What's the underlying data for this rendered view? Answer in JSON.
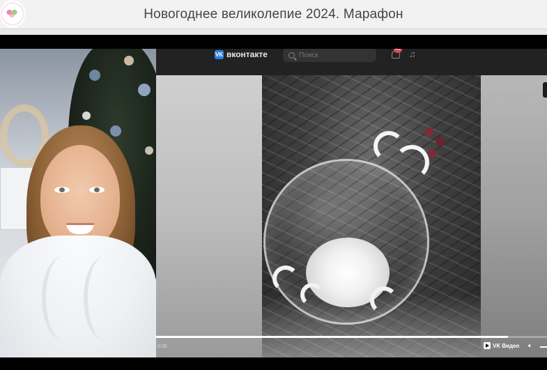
{
  "header": {
    "title": "Новогоднее великолепие 2024. Марафон",
    "logo_icon": "flower-logo-icon",
    "background": "#f2f2f2"
  },
  "vk": {
    "brand_name": "вконтакте",
    "brand_icon": "vk-logo-icon",
    "search_placeholder": "Поиск",
    "notifications_count": "41",
    "music_icon": "music-note-icon",
    "accent": "#2d81e0"
  },
  "player": {
    "time": "0:20",
    "progress": 0.9,
    "label": "VK Видео",
    "volume_icon": "volume-icon"
  }
}
